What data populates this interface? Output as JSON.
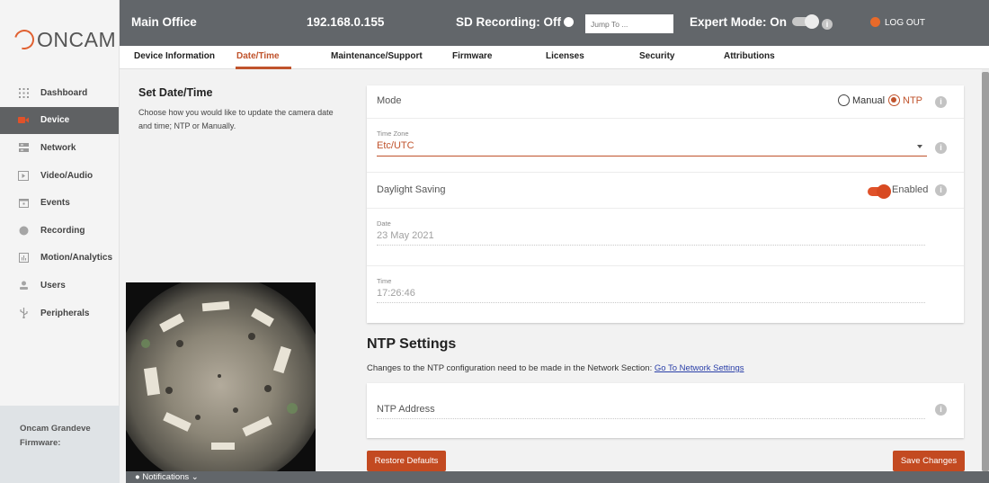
{
  "brand": {
    "logo_text": "ONCAM"
  },
  "sidebar": {
    "items": [
      {
        "label": "Dashboard",
        "icon": "dashboard-grid-icon"
      },
      {
        "label": "Device",
        "icon": "camera-icon",
        "active": true
      },
      {
        "label": "Network",
        "icon": "network-icon"
      },
      {
        "label": "Video/Audio",
        "icon": "video-play-icon"
      },
      {
        "label": "Events",
        "icon": "calendar-icon"
      },
      {
        "label": "Recording",
        "icon": "record-dot-icon"
      },
      {
        "label": "Motion/Analytics",
        "icon": "analytics-chart-icon"
      },
      {
        "label": "Users",
        "icon": "user-icon"
      },
      {
        "label": "Peripherals",
        "icon": "usb-icon"
      }
    ],
    "footer": {
      "model": "Oncam Grandeve",
      "firmware_label": "Firmware:"
    }
  },
  "header": {
    "location": "Main Office",
    "ip": "192.168.0.155",
    "sd_recording": "SD Recording: Off",
    "jump_placeholder": "Jump To ...",
    "expert_mode": "Expert Mode: On",
    "logout": "LOG OUT"
  },
  "tabs": [
    "Device Information",
    "Date/Time",
    "Maintenance/Support",
    "Firmware",
    "Licenses",
    "Security",
    "Attributions"
  ],
  "active_tab": "Date/Time",
  "intro": {
    "title": "Set Date/Time",
    "description": "Choose how you would like to update the camera date and time; NTP or Manually."
  },
  "datetime": {
    "mode_label": "Mode",
    "mode_options": [
      "Manual",
      "NTP"
    ],
    "mode_selected": "NTP",
    "timezone_label": "Time Zone",
    "timezone_value": "Etc/UTC",
    "daylight_label": "Daylight Saving",
    "daylight_state": "Enabled",
    "date_label": "Date",
    "date_value": "23 May 2021",
    "time_label": "Time",
    "time_value": "17:26:46"
  },
  "ntp": {
    "title": "NTP Settings",
    "description": "Changes to the NTP configuration need to be made in the Network Section:",
    "link": "Go To Network Settings",
    "address_label": "NTP Address"
  },
  "buttons": {
    "restore": "Restore Defaults",
    "save": "Save Changes"
  },
  "notifications": {
    "label": "Notifications"
  },
  "colors": {
    "accent": "#c0532c",
    "header_bg": "#62666a",
    "button_bg": "#c34a21"
  }
}
